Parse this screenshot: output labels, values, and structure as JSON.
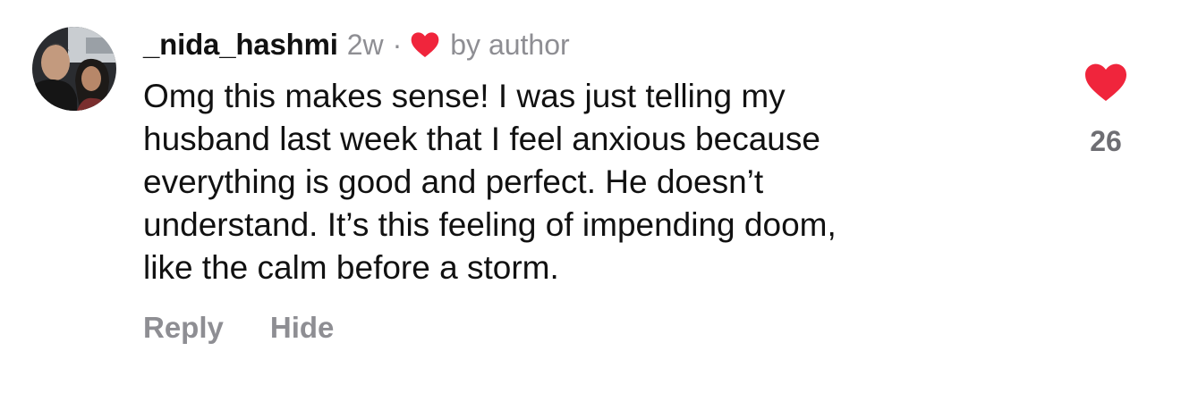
{
  "comment": {
    "username": "_nida_hashmi",
    "time": "2w",
    "separator": "·",
    "liked_by_author_label": "by author",
    "body_lines": [
      "Omg this makes sense! I was just telling my",
      "husband last week that I feel anxious because",
      "everything is good and perfect. He doesn’t",
      "understand. It’s this feeling of impending doom,",
      "like the calm before a storm."
    ],
    "actions": {
      "reply": "Reply",
      "hide": "Hide"
    },
    "like_count": "26",
    "like_icon": "heart-filled-icon",
    "author_like_icon": "heart-filled-icon",
    "colors": {
      "heart": "#f0253c",
      "meta": "#8e8e93",
      "text": "#111111"
    }
  }
}
